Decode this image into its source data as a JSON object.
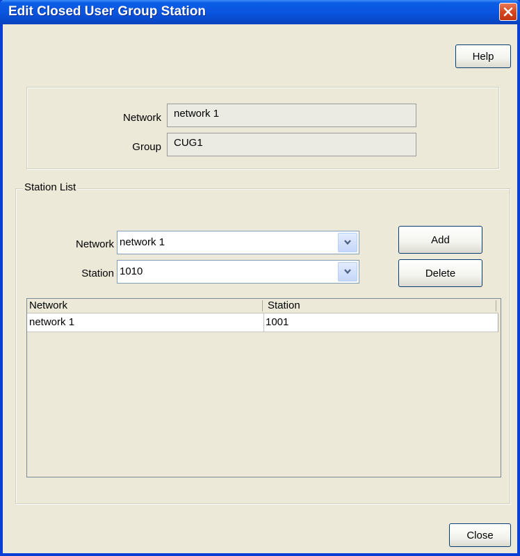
{
  "window": {
    "title": "Edit Closed User Group Station",
    "close_icon": "close-x-icon"
  },
  "toolbar": {
    "help_label": "Help"
  },
  "info": {
    "network_label": "Network",
    "network_value": "network 1",
    "group_label": "Group",
    "group_value": "CUG1"
  },
  "station_list": {
    "legend": "Station List",
    "network_label": "Network",
    "network_selected": "network 1",
    "station_label": "Station",
    "station_selected": "1010",
    "add_label": "Add",
    "delete_label": "Delete",
    "columns": [
      "Network",
      "Station"
    ],
    "rows": [
      [
        "network 1",
        "1001"
      ]
    ]
  },
  "footer": {
    "close_label": "Close"
  },
  "colors": {
    "titlebar": "#0a55e0",
    "background": "#ece9d8",
    "close_button": "#d6471f"
  }
}
